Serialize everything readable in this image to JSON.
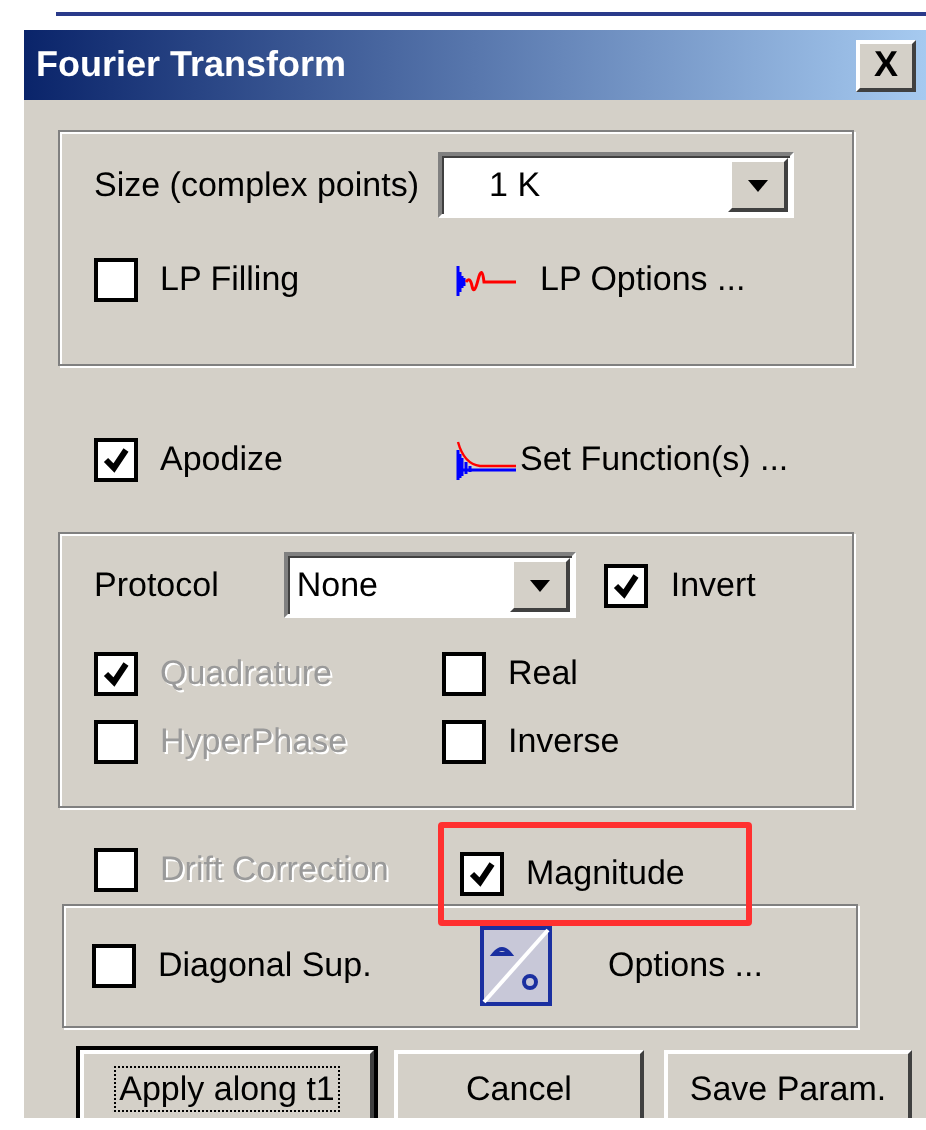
{
  "window": {
    "title": "Fourier Transform",
    "close_label": "X"
  },
  "size_group": {
    "label": "Size (complex points)",
    "dropdown": {
      "value": "1 K"
    },
    "lp_filling": {
      "label": "LP Filling",
      "checked": false,
      "disabled": false
    },
    "lp_options": {
      "label": "LP Options ..."
    }
  },
  "apodize": {
    "label": "Apodize",
    "checked": true,
    "disabled": false
  },
  "set_functions": {
    "label": "Set Function(s) ..."
  },
  "protocol_group": {
    "label": "Protocol",
    "dropdown": {
      "value": "None"
    },
    "invert": {
      "label": "Invert",
      "checked": true,
      "disabled": false
    },
    "options": [
      {
        "label": "Quadrature",
        "checked": true,
        "disabled": true
      },
      {
        "label": "Real",
        "checked": false,
        "disabled": false
      },
      {
        "label": "HyperPhase",
        "checked": false,
        "disabled": true
      },
      {
        "label": "Inverse",
        "checked": false,
        "disabled": false
      }
    ]
  },
  "drift_correction": {
    "label": "Drift Correction",
    "checked": false,
    "disabled": true,
    "highlighted": false
  },
  "magnitude": {
    "label": "Magnitude",
    "checked": true,
    "disabled": false,
    "highlighted": true
  },
  "diagonal_group": {
    "diagonal_sup": {
      "label": "Diagonal Sup.",
      "checked": false,
      "disabled": false
    },
    "options": {
      "label": "Options ..."
    }
  },
  "buttons": [
    {
      "label": "Apply along t1",
      "default": true
    },
    {
      "label": "Cancel",
      "default": false
    },
    {
      "label": "Save Param.",
      "default": false
    }
  ]
}
